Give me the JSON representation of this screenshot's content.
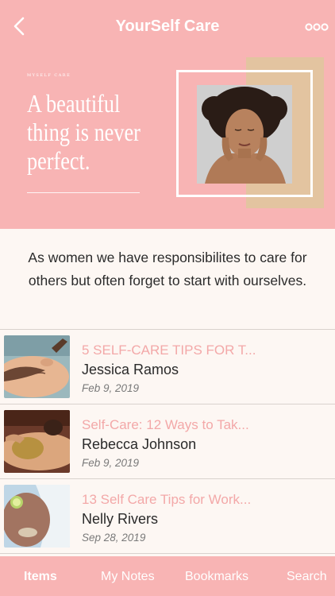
{
  "header": {
    "title": "YourSelf Care",
    "back_icon": "chevron-left-icon",
    "more_icon": "more-horizontal-icon"
  },
  "hero": {
    "eyebrow": "MYSELF CARE",
    "quote": "A beautiful thing is never perfect."
  },
  "intro": "As women we have responsibilites to care for others but often forget to start with ourselves.",
  "articles": [
    {
      "title": "5 SELF-CARE TIPS FOR T...",
      "author": "Jessica Ramos",
      "date": "Feb 9, 2019"
    },
    {
      "title": "Self-Care: 12 Ways to Tak...",
      "author": "Rebecca Johnson",
      "date": "Feb 9, 2019"
    },
    {
      "title": "13 Self Care Tips for Work...",
      "author": "Nelly Rivers",
      "date": "Sep 28, 2019"
    }
  ],
  "tabs": [
    {
      "label": "Items",
      "active": true
    },
    {
      "label": "My Notes",
      "active": false
    },
    {
      "label": "Bookmarks",
      "active": false
    },
    {
      "label": "Search",
      "active": false
    }
  ],
  "colors": {
    "accent": "#f8b4b4",
    "title_pink": "#f3a8a8",
    "beige": "#e3c4a0",
    "background": "#fdf7f3"
  }
}
